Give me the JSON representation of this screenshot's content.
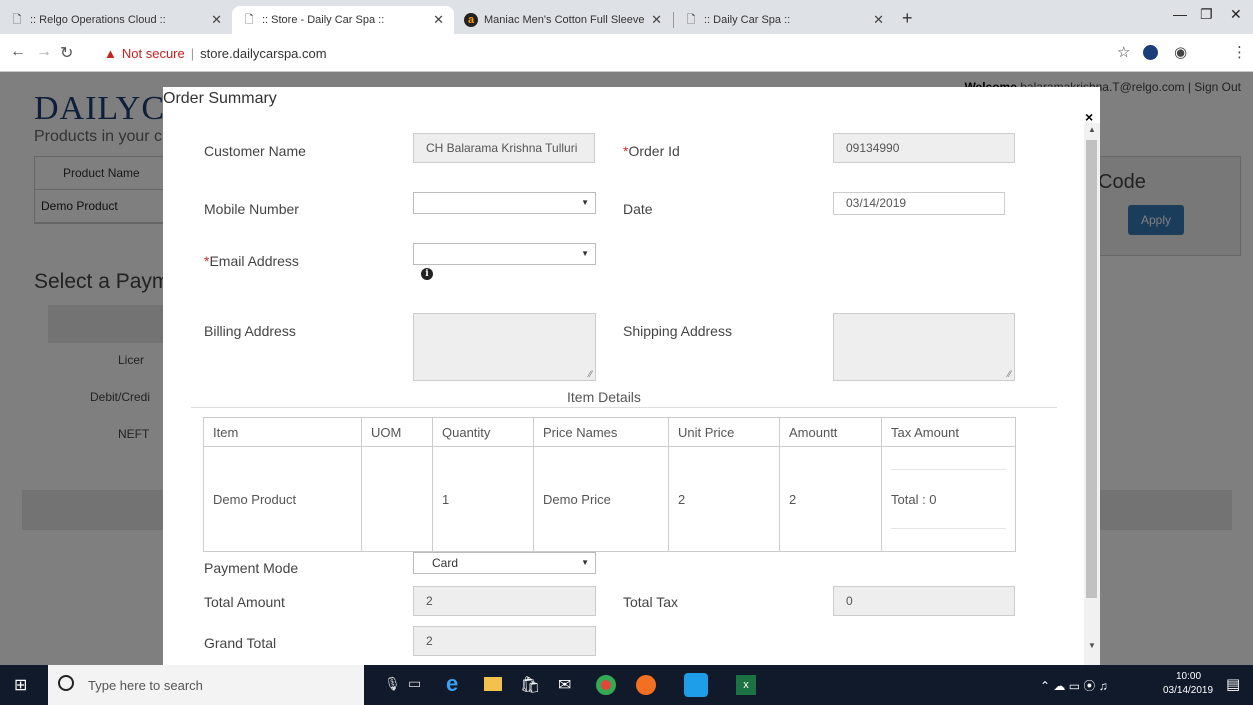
{
  "browser": {
    "tabs": [
      {
        "title": ":: Relgo Operations Cloud ::",
        "icon": "document-icon"
      },
      {
        "title": ":: Store - Daily Car Spa ::",
        "icon": "document-icon"
      },
      {
        "title": "Maniac Men's Cotton Full Sleeve",
        "icon": "amazon-icon"
      },
      {
        "title": ":: Daily Car Spa ::",
        "icon": "document-icon"
      }
    ],
    "not_secure": "Not secure",
    "url": "store.dailycarspa.com"
  },
  "page": {
    "logo": "DAILYCA",
    "welcome_label": "Welcome",
    "user_email": "balaramakrishna.T@relgo.com",
    "sign_out": "Sign Out",
    "products_heading": "Products in your c",
    "product_column": "Product Name",
    "product_row": "Demo Product",
    "payment_heading": "Select a Paym",
    "payment_options": [
      "Licer",
      "Debit/Credi",
      "NEFT"
    ],
    "promo_title": "Code",
    "apply_label": "Apply"
  },
  "modal": {
    "title": "Order Summary",
    "close": "×",
    "customer_name_label": "Customer Name",
    "customer_name_value": "CH Balarama Krishna Tulluri",
    "order_id_label": "Order Id",
    "order_id_value": "09134990",
    "mobile_label": "Mobile Number",
    "mobile_value": "",
    "date_label": "Date",
    "date_value": "03/14/2019",
    "email_label": "Email Address",
    "email_value": "",
    "billing_label": "Billing Address",
    "shipping_label": "Shipping Address",
    "item_details_title": "Item Details",
    "items_columns": [
      "Item",
      "UOM",
      "Quantity",
      "Price Names",
      "Unit Price",
      "Amountt",
      "Tax Amount"
    ],
    "items_rows": [
      {
        "item": "Demo Product",
        "uom": "",
        "quantity": "1",
        "price_names": "Demo Price",
        "unit_price": "2",
        "amount": "2",
        "tax_amount": "Total : 0"
      }
    ],
    "payment_mode_label": "Payment Mode",
    "payment_mode_value": "Card",
    "total_amount_label": "Total Amount",
    "total_amount_value": "2",
    "total_tax_label": "Total Tax",
    "total_tax_value": "0",
    "grand_total_label": "Grand Total",
    "grand_total_value": "2"
  },
  "taskbar": {
    "search_placeholder": "Type here to search",
    "time": "10:00",
    "date": "03/14/2019"
  }
}
